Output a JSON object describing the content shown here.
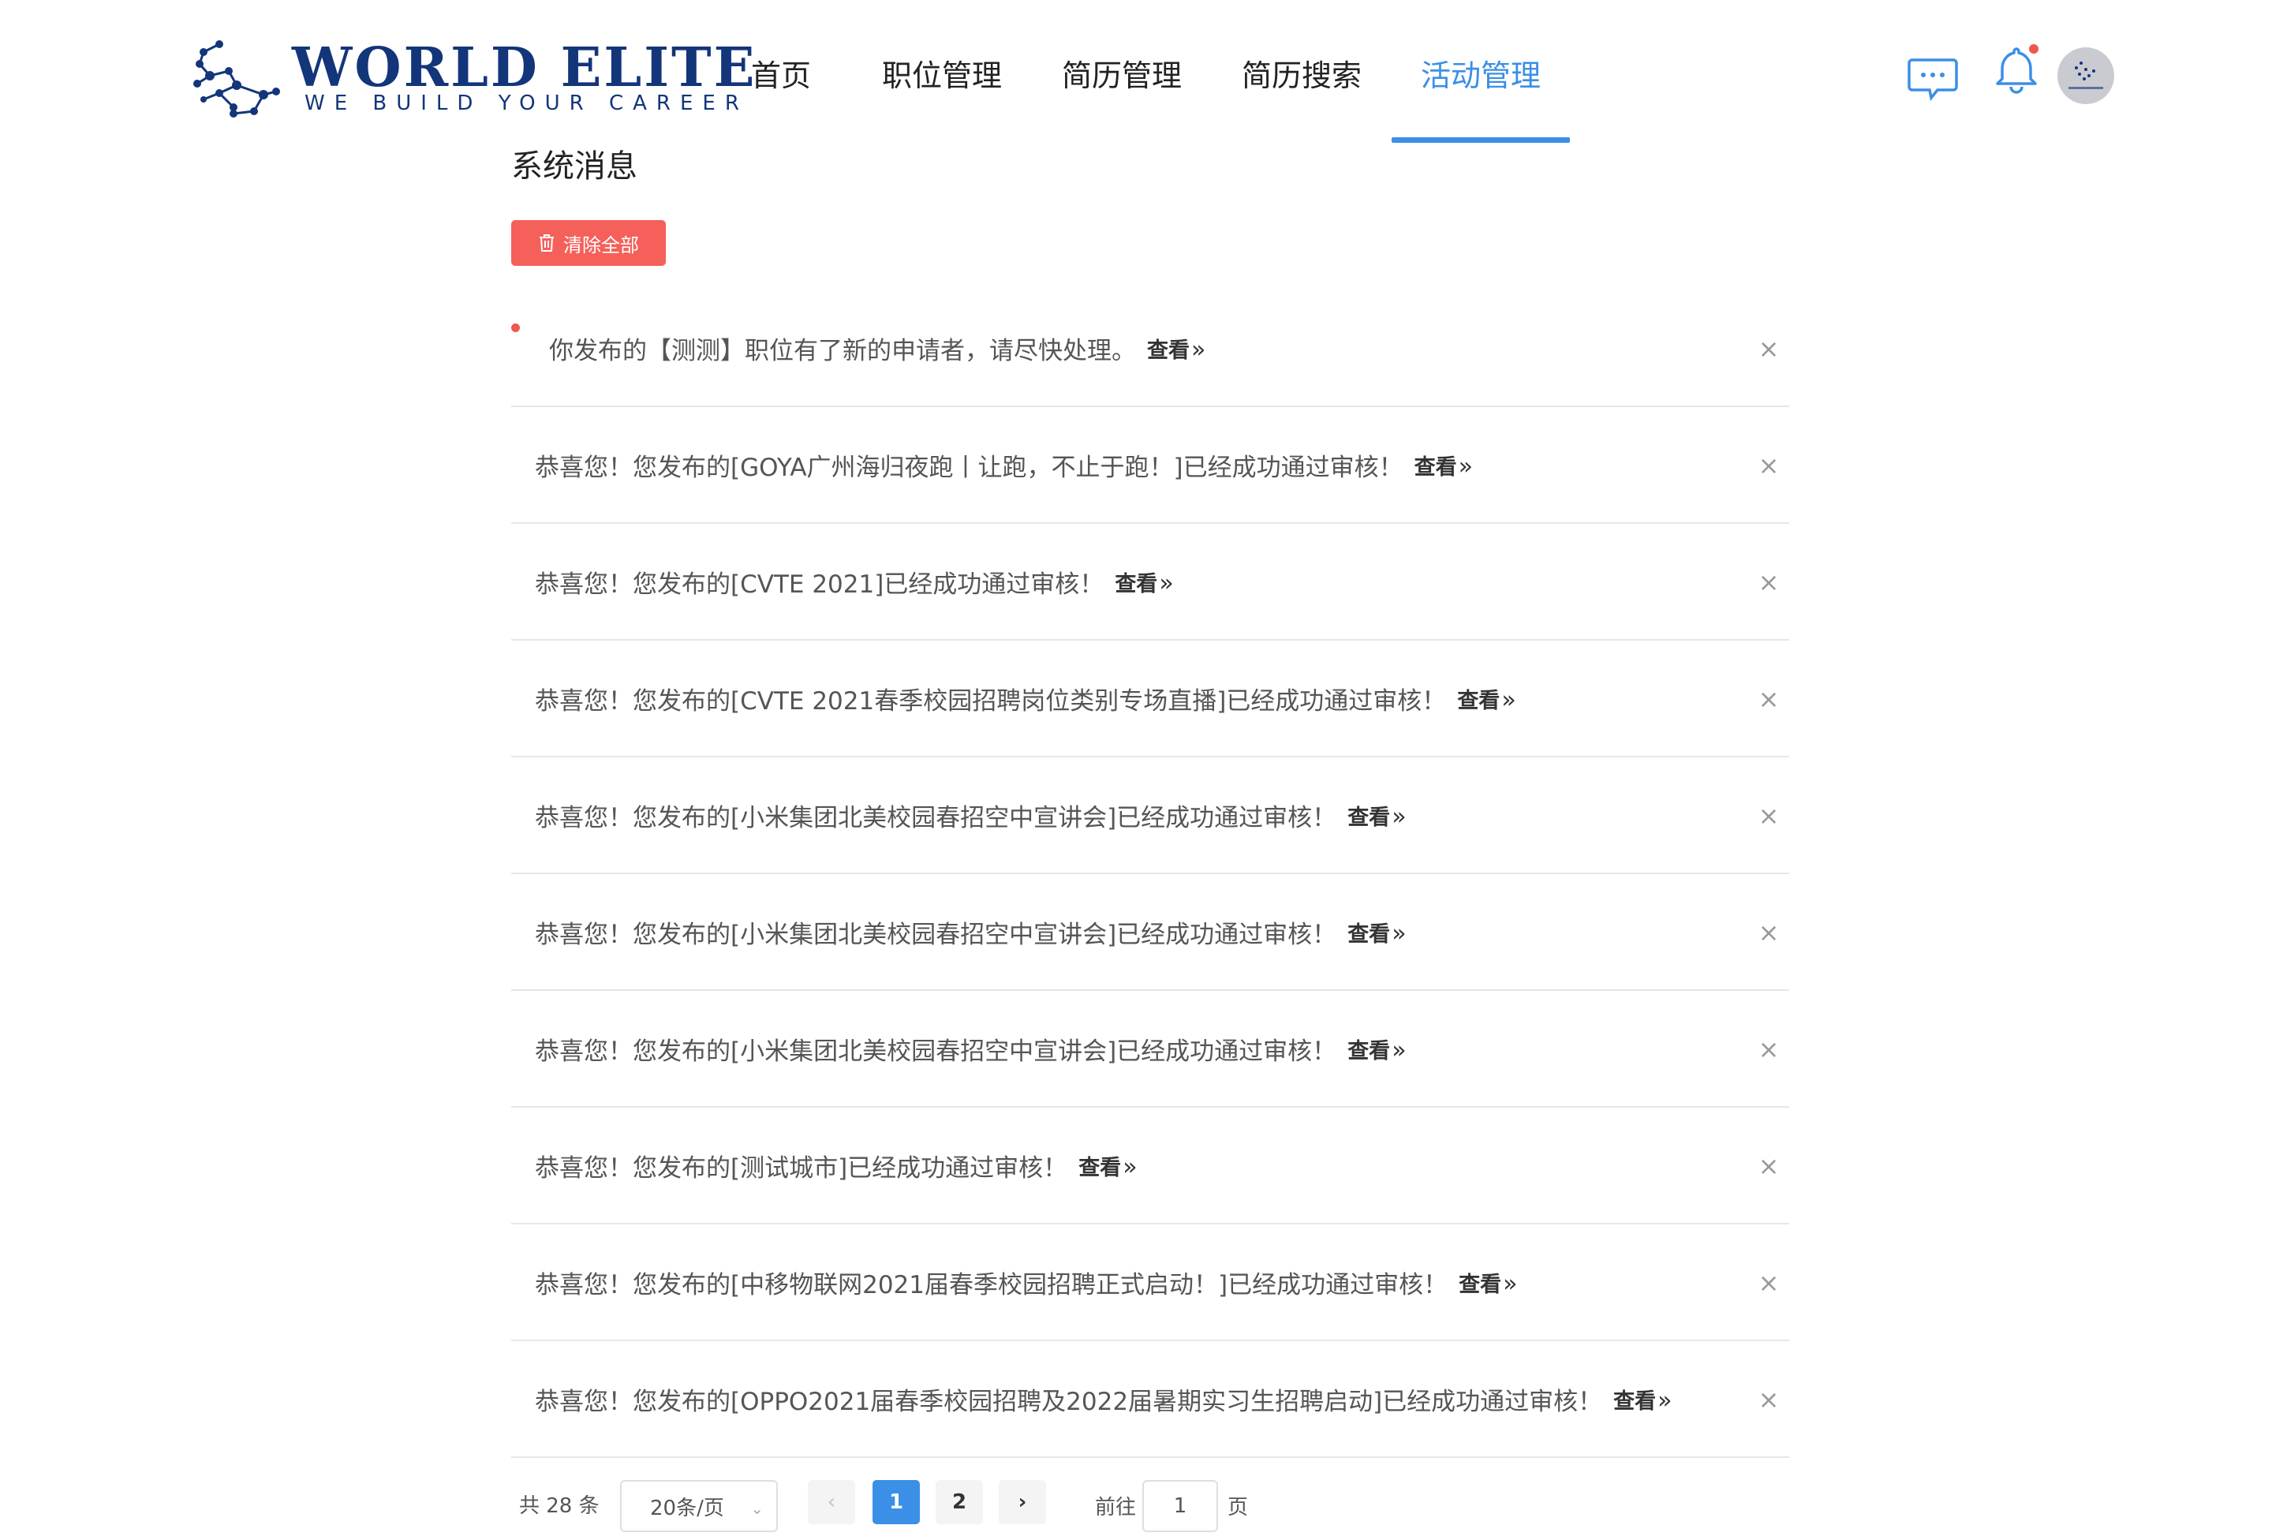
{
  "header": {
    "logo_title": "WORLD ELITE",
    "logo_subtitle": "WE BUILD YOUR CAREER",
    "nav": [
      {
        "label": "首页",
        "active": false
      },
      {
        "label": "职位管理",
        "active": false
      },
      {
        "label": "简历管理",
        "active": false
      },
      {
        "label": "简历搜索",
        "active": false
      },
      {
        "label": "活动管理",
        "active": true
      }
    ],
    "icons": [
      "chat-icon",
      "bell-icon",
      "avatar"
    ]
  },
  "main": {
    "title": "系统消息",
    "clear_all_label": "清除全部",
    "view_label": "查看",
    "messages": [
      {
        "text": "你发布的【测测】职位有了新的申请者，请尽快处理。",
        "unread": true
      },
      {
        "text": "恭喜您！您发布的[GOYA广州海归夜跑丨让跑，不止于跑！]已经成功通过审核！",
        "unread": false
      },
      {
        "text": "恭喜您！您发布的[CVTE 2021]已经成功通过审核！",
        "unread": false
      },
      {
        "text": "恭喜您！您发布的[CVTE 2021春季校园招聘岗位类别专场直播]已经成功通过审核！",
        "unread": false
      },
      {
        "text": "恭喜您！您发布的[小米集团北美校园春招空中宣讲会]已经成功通过审核！",
        "unread": false
      },
      {
        "text": "恭喜您！您发布的[小米集团北美校园春招空中宣讲会]已经成功通过审核！",
        "unread": false
      },
      {
        "text": "恭喜您！您发布的[小米集团北美校园春招空中宣讲会]已经成功通过审核！",
        "unread": false
      },
      {
        "text": "恭喜您！您发布的[测试城市]已经成功通过审核！",
        "unread": false
      },
      {
        "text": "恭喜您！您发布的[中移物联网2021届春季校园招聘正式启动！]已经成功通过审核！",
        "unread": false
      },
      {
        "text": "恭喜您！您发布的[OPPO2021届春季校园招聘及2022届暑期实习生招聘启动]已经成功通过审核！",
        "unread": false
      }
    ]
  },
  "pagination": {
    "total_label": "共 28 条",
    "page_size": "20条/页",
    "pages": [
      "1",
      "2"
    ],
    "current_page": "1",
    "goto_label": "前往",
    "goto_value": "1",
    "page_suffix": "页"
  },
  "colors": {
    "accent": "#3b8fe6",
    "danger": "#f5605a",
    "logo": "#13357a"
  }
}
